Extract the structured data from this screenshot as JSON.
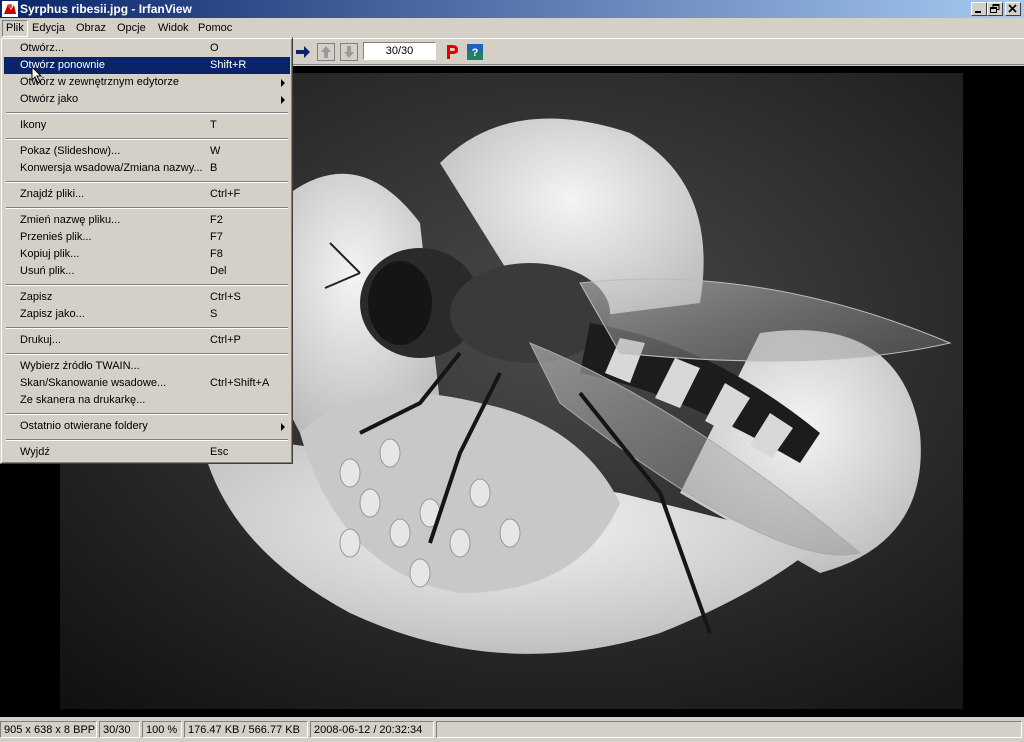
{
  "window": {
    "title": "Syrphus ribesii.jpg - IrfanView"
  },
  "menubar": [
    "Plik",
    "Edycja",
    "Obraz",
    "Opcje",
    "Widok",
    "Pomoc"
  ],
  "toolbar": {
    "counter": "30/30"
  },
  "file_menu": {
    "items": [
      {
        "label": "Otwórz...",
        "shortcut": "O"
      },
      {
        "label": "Otwórz ponownie",
        "shortcut": "Shift+R"
      },
      {
        "label": "Otwórz w zewnętrznym edytorze",
        "shortcut": ""
      },
      {
        "label": "Otwórz jako",
        "shortcut": ""
      },
      {
        "label": "Ikony",
        "shortcut": "T"
      },
      {
        "label": "Pokaz (Slideshow)...",
        "shortcut": "W"
      },
      {
        "label": "Konwersja wsadowa/Zmiana nazwy...",
        "shortcut": "B"
      },
      {
        "label": "Znajdź pliki...",
        "shortcut": "Ctrl+F"
      },
      {
        "label": "Zmień nazwę pliku...",
        "shortcut": "F2"
      },
      {
        "label": "Przenieś plik...",
        "shortcut": "F7"
      },
      {
        "label": "Kopiuj plik...",
        "shortcut": "F8"
      },
      {
        "label": "Usuń plik...",
        "shortcut": "Del"
      },
      {
        "label": "Zapisz",
        "shortcut": "Ctrl+S"
      },
      {
        "label": "Zapisz jako...",
        "shortcut": "S"
      },
      {
        "label": "Drukuj...",
        "shortcut": "Ctrl+P"
      },
      {
        "label": "Wybierz źródło TWAIN...",
        "shortcut": ""
      },
      {
        "label": "Skan/Skanowanie wsadowe...",
        "shortcut": "Ctrl+Shift+A"
      },
      {
        "label": "Ze skanera na drukarkę...",
        "shortcut": ""
      },
      {
        "label": "Ostatnio otwierane foldery",
        "shortcut": ""
      },
      {
        "label": "Wyjdź",
        "shortcut": "Esc"
      }
    ]
  },
  "statusbar": [
    "905 x 638 x 8 BPP",
    "30/30",
    "100 %",
    "176.47 KB / 566.77 KB",
    "2008-06-12 / 20:32:34",
    ""
  ],
  "colors": {
    "menu_highlight": "#0a246a",
    "title_gradient_start": "#0a246a",
    "title_gradient_end": "#a6caf0"
  }
}
